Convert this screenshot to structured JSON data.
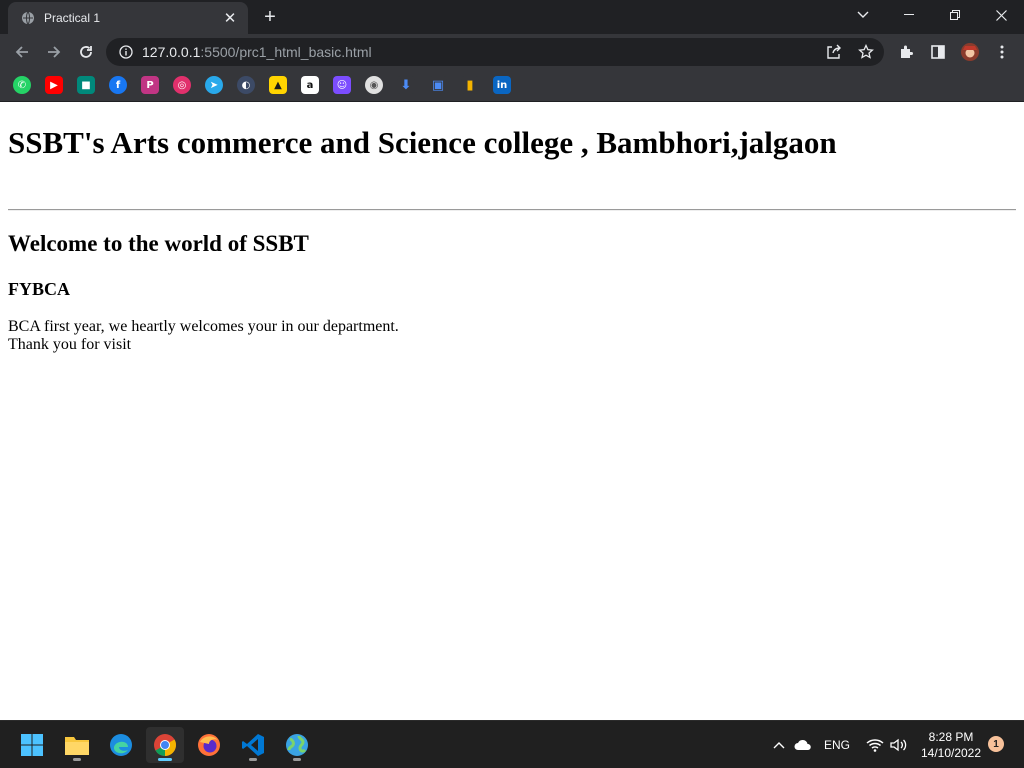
{
  "browser": {
    "tab": {
      "title": "Practical 1",
      "favicon": "globe-icon"
    },
    "new_tab_icon": "plus-icon",
    "window_controls": [
      "tab-search-icon",
      "minimize-icon",
      "restore-icon",
      "close-icon"
    ],
    "address_bar": {
      "host": "127.0.0.1",
      "path": ":5500/prc1_html_basic.html",
      "icons": [
        "info-icon",
        "share-icon",
        "star-icon"
      ]
    },
    "toolbar_icons": [
      "back-icon",
      "forward-icon",
      "reload-icon",
      "extensions-icon",
      "side-panel-icon",
      "profile-avatar",
      "menu-icon"
    ],
    "bookmarks": [
      {
        "name": "whatsapp",
        "glyph": "✆",
        "color": "#25d366"
      },
      {
        "name": "youtube",
        "glyph": "▶",
        "color": "#ff0000"
      },
      {
        "name": "google-meet",
        "glyph": "■",
        "color": "#00897b"
      },
      {
        "name": "facebook",
        "glyph": "f",
        "color": "#1877f2"
      },
      {
        "name": "picsart",
        "glyph": "P",
        "color": "#c13584"
      },
      {
        "name": "instagram",
        "glyph": "◎",
        "color": "#e1306c"
      },
      {
        "name": "telegram",
        "glyph": "➤",
        "color": "#29a9eb"
      },
      {
        "name": "dark-reader",
        "glyph": "◐",
        "color": "#3c4a66"
      },
      {
        "name": "shopping",
        "glyph": "▲",
        "color": "#ffd400"
      },
      {
        "name": "amazon",
        "glyph": "a",
        "color": "#ffffff"
      },
      {
        "name": "contacts",
        "glyph": "☺",
        "color": "#7c4dff"
      },
      {
        "name": "chrome-web-store",
        "glyph": "◉",
        "color": "#e0e0e0"
      },
      {
        "name": "downloads",
        "glyph": "⬇",
        "color": "#35363a"
      },
      {
        "name": "bilibili",
        "glyph": "▣",
        "color": "#35363a"
      },
      {
        "name": "analytics",
        "glyph": "▮",
        "color": "#35363a"
      },
      {
        "name": "linkedin",
        "glyph": "in",
        "color": "#0a66c2"
      }
    ]
  },
  "page": {
    "h1": "SSBT's Arts commerce and Science college , Bambhori,jalgaon",
    "h2": "Welcome to the world of SSBT",
    "h3": "FYBCA",
    "paragraph_lines": [
      "BCA first year, we heartly welcomes your in our department.",
      "Thank you for visit"
    ]
  },
  "taskbar": {
    "apps": [
      "start-icon",
      "file-explorer-icon",
      "edge-icon",
      "chrome-icon",
      "firefox-icon",
      "vscode-icon",
      "globe-app-icon"
    ],
    "tray": {
      "language": "ENG",
      "time": "8:28 PM",
      "date": "14/10/2022",
      "notification_count": "1"
    }
  }
}
